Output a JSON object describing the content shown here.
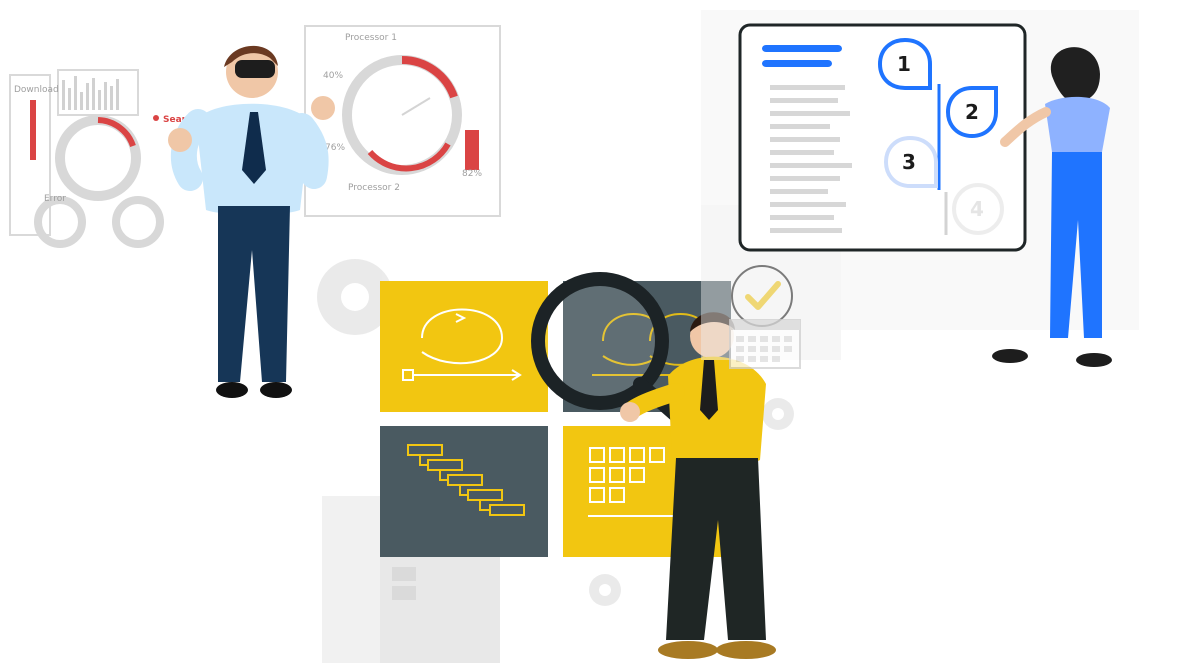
{
  "hud": {
    "download": "Download",
    "processor_1": "Processor 1",
    "processor_2": "Processor 2",
    "search": "Search",
    "error": "Error",
    "pct_40": "40%",
    "pct_82": "82%",
    "pct_76": "76%"
  },
  "steps": [
    {
      "label": "1"
    },
    {
      "label": "2"
    },
    {
      "label": "3"
    },
    {
      "label": "4"
    }
  ],
  "colors": {
    "blue": "#1f74ff",
    "yellow": "#f2c611",
    "slate": "#4a5a61",
    "red": "#d93b3b",
    "gray": "#c9cbd0"
  }
}
